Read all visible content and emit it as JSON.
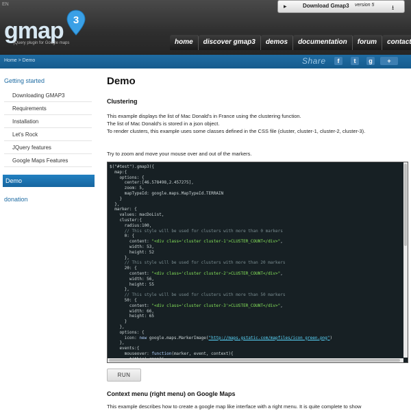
{
  "header": {
    "lang": "EN",
    "logo_text": "gmap",
    "logo_badge": "3",
    "logo_tagline": "jQuery plugin for Google maps",
    "download_label": "Download Gmap3",
    "download_version": "version 5"
  },
  "nav": [
    "home",
    "discover gmap3",
    "demos",
    "documentation",
    "forum",
    "contact"
  ],
  "crumb": {
    "breadcrumb": "Home > Demo",
    "share_label": "Share",
    "social": [
      "f",
      "t",
      "g",
      "+"
    ]
  },
  "sidebar": {
    "getting_started": "Getting started",
    "items": [
      "Downloading GMAP3",
      "Requirements",
      "Installation",
      "Let's Rock",
      "JQuery features",
      "Google Maps Features"
    ],
    "demo": "Demo",
    "donation": "donation"
  },
  "main": {
    "title": "Demo",
    "section_title": "Clustering",
    "p1": "This example displays the list of Mac Donald's in France using the clustering function.",
    "p2": "The list of Mac Donald's is stored in a json object.",
    "p3": "To render clusters, this example uses some classes defined in the CSS file (cluster, cluster-1, cluster-2, cluster-3).",
    "p4": "Try to zoom and move your mouse over and out of the markers.",
    "run_label": "RUN",
    "ctx_title": "Context menu (right menu) on Google Maps",
    "ctx_para": "This example describes how to create a google map like interface with a right menu. It is quite complete to show"
  },
  "colors": {
    "header_bg": "#2e2e2e",
    "crumb_bg": "#1f6ca3",
    "code_bg": "#172024",
    "accent": "#1f6ca3"
  }
}
